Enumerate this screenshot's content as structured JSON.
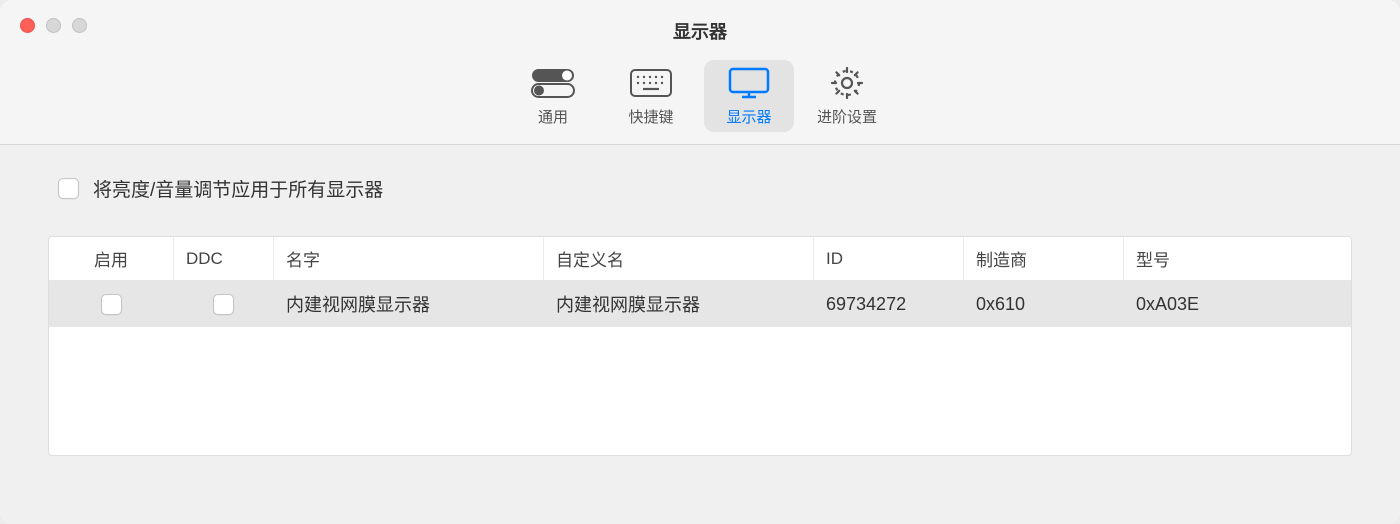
{
  "window": {
    "title": "显示器"
  },
  "toolbar": {
    "general": "通用",
    "shortcut": "快捷键",
    "display": "显示器",
    "advanced": "进阶设置"
  },
  "checkbox": {
    "label": "将亮度/音量调节应用于所有显示器"
  },
  "table": {
    "headers": {
      "enable": "启用",
      "ddc": "DDC",
      "name": "名字",
      "custom": "自定义名",
      "id": "ID",
      "mfg": "制造商",
      "model": "型号"
    },
    "rows": [
      {
        "name": "内建视网膜显示器",
        "custom": "内建视网膜显示器",
        "id": "69734272",
        "mfg": "0x610",
        "model": "0xA03E"
      }
    ]
  }
}
